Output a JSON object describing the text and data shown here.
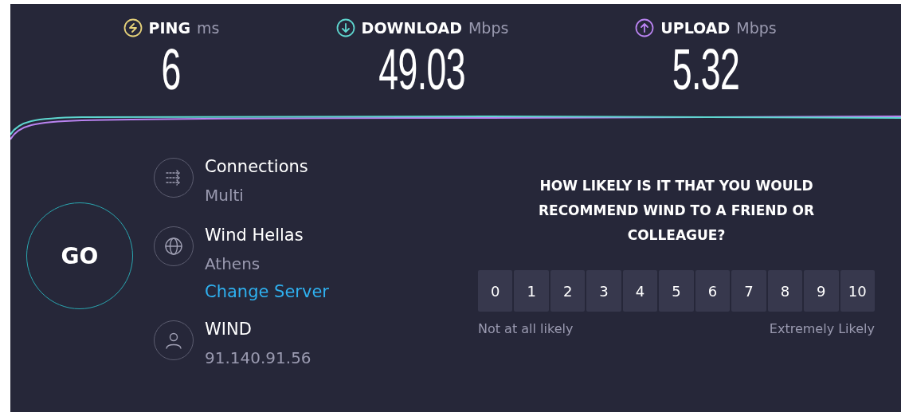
{
  "metrics": [
    {
      "label": "PING",
      "unit": "ms",
      "value": "6",
      "color": "#e6d27a",
      "kind": "ping"
    },
    {
      "label": "DOWNLOAD",
      "unit": "Mbps",
      "value": "49.03",
      "color": "#5ed6cf",
      "kind": "download"
    },
    {
      "label": "UPLOAD",
      "unit": "Mbps",
      "value": "5.32",
      "color": "#b983f0",
      "kind": "upload"
    }
  ],
  "go_button": "GO",
  "info": [
    {
      "kind": "connections",
      "title": "Connections",
      "subtitle": "Multi"
    },
    {
      "kind": "server",
      "title": "Wind Hellas",
      "subtitle": "Athens",
      "link": "Change Server"
    },
    {
      "kind": "provider",
      "title": "WIND",
      "subtitle": "91.140.91.56"
    }
  ],
  "survey": {
    "question": "HOW LIKELY IS IT THAT YOU WOULD RECOMMEND WIND TO A FRIEND OR COLLEAGUE?",
    "scale": [
      {
        "label": "0",
        "selected": false
      },
      {
        "label": "1",
        "selected": false
      },
      {
        "label": "2",
        "selected": false
      },
      {
        "label": "3",
        "selected": false
      },
      {
        "label": "4",
        "selected": false
      },
      {
        "label": "5",
        "selected": false
      },
      {
        "label": "6",
        "selected": false
      },
      {
        "label": "7",
        "selected": false
      },
      {
        "label": "8",
        "selected": false
      },
      {
        "label": "9",
        "selected": false
      },
      {
        "label": "10",
        "selected": false
      }
    ],
    "low_label": "Not at all likely",
    "high_label": "Extremely Likely"
  }
}
